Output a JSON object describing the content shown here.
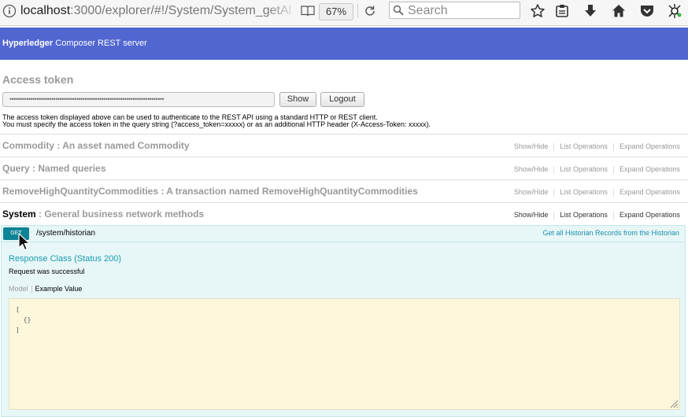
{
  "browser": {
    "url_host": "localhost",
    "url_path": ":3000/explorer/#!/System/System_getAl",
    "zoom": "67%",
    "search_placeholder": "Search",
    "toolbar_icons": [
      "bookmark-star-icon",
      "clipboard-icon",
      "download-icon",
      "home-icon",
      "pocket-icon",
      "extension-icon"
    ]
  },
  "header": {
    "brand": "Hyperledger",
    "subtitle": " Composer REST server",
    "color": "#5166d1"
  },
  "access_token": {
    "heading": "Access token",
    "token_value": "••••••••••••••••••••••••••••••••••••••••••••••••••••••••••••••••••••••••••",
    "show_label": "Show",
    "logout_label": "Logout",
    "note_line1": "The access token displayed above can be used to authenticate to the REST API using a standard HTTP or REST client.",
    "note_line2": "You must specify the access token in the query string (?access_token=xxxxx) or as an additional HTTP header (X-Access-Token: xxxxx)."
  },
  "resources": [
    {
      "name": "Commodity",
      "desc": " : An asset named Commodity",
      "show_hide": "Show/Hide",
      "list_ops": "List Operations",
      "expand_ops": "Expand Operations"
    },
    {
      "name": "Query",
      "desc": " : Named queries",
      "show_hide": "Show/Hide",
      "list_ops": "List Operations",
      "expand_ops": "Expand Operations"
    },
    {
      "name": "RemoveHighQuantityCommodities",
      "desc": " : A transaction named RemoveHighQuantityCommodities",
      "show_hide": "Show/Hide",
      "list_ops": "List Operations",
      "expand_ops": "Expand Operations"
    },
    {
      "name": "System",
      "desc": " : General business network methods",
      "show_hide": "Show/Hide",
      "list_ops": "List Operations",
      "expand_ops": "Expand Operations"
    }
  ],
  "operation": {
    "method": "GET",
    "path": "/system/historian",
    "summary": "Get all Historian Records from the Historian",
    "response_class": "Response Class (Status 200)",
    "response_desc": "Request was successful",
    "tab_model": "Model",
    "tab_example": "Example Value",
    "example_lines": [
      "[",
      "  {}",
      "]"
    ]
  }
}
